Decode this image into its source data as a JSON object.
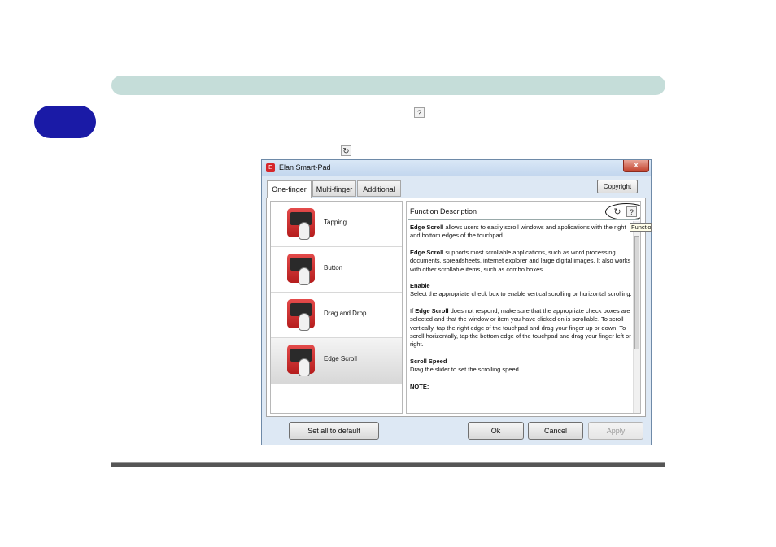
{
  "document": {
    "inline_help_glyph": "?",
    "inline_refresh_glyph": "↻"
  },
  "window": {
    "title": "Elan Smart-Pad",
    "close_glyph": "x",
    "tabs": [
      {
        "label": "One-finger",
        "active": true
      },
      {
        "label": "Multi-finger",
        "active": false
      },
      {
        "label": "Additional",
        "active": false
      }
    ],
    "copyright_label": "Copyright",
    "functions": [
      {
        "label": "Tapping",
        "icon": "tapping-icon",
        "selected": false
      },
      {
        "label": "Button",
        "icon": "button-icon",
        "selected": false
      },
      {
        "label": "Drag and Drop",
        "icon": "drag-and-drop-icon",
        "selected": false
      },
      {
        "label": "Edge Scroll",
        "icon": "edge-scroll-icon",
        "selected": true
      }
    ],
    "description": {
      "header": "Function Description",
      "refresh_glyph": "↻",
      "help_glyph": "?",
      "tooltip": "Function",
      "p1_bold": "Edge Scroll",
      "p1_text": " allows users to easily scroll windows and applications with the right and bottom edges of the touchpad.",
      "p2_bold": "Edge Scroll",
      "p2_text": " supports most scrollable applications, such as word processing documents, spreadsheets, internet explorer and large digital images. It also works with other scrollable items, such as combo boxes.",
      "p3_heading": "Enable",
      "p3_text": "Select the appropriate check box to enable vertical scrolling or horizontal scrolling.",
      "p4_prefix": "If ",
      "p4_bold": "Edge Scroll",
      "p4_text": " does not respond, make sure that the appropriate check boxes are selected and that the window or item you have clicked on is scrollable. To scroll vertically, tap the right edge of the touchpad and drag your finger up or down. To scroll horizontally, tap the bottom edge of the touchpad and drag your finger left or right.",
      "p5_heading": "Scroll Speed",
      "p5_text": "Drag the slider to set the scrolling speed.",
      "p6_heading": "NOTE:"
    },
    "buttons": {
      "set_default": "Set all to default",
      "ok": "Ok",
      "cancel": "Cancel",
      "apply": "Apply"
    }
  },
  "colors": {
    "header_bar": "#c5ddd9",
    "chapter_tab": "#1a1aa6",
    "icon_red": "#d6262b"
  }
}
